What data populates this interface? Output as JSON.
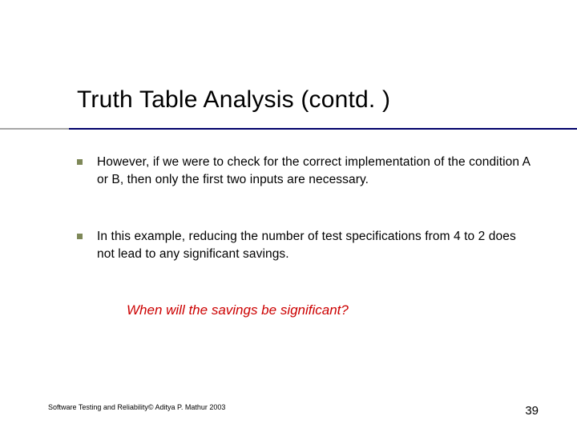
{
  "slide": {
    "title": "Truth Table Analysis (contd. )",
    "bullets": [
      "However, if we were to check for the correct implementation of the condition A or B, then only the first two inputs are necessary.",
      "In this example, reducing the number of test specifications from 4 to 2 does not lead to any significant savings."
    ],
    "callout": "When will the savings be significant?",
    "footer_left": "Software Testing and Reliability© Aditya P. Mathur 2003",
    "page_number": "39"
  }
}
